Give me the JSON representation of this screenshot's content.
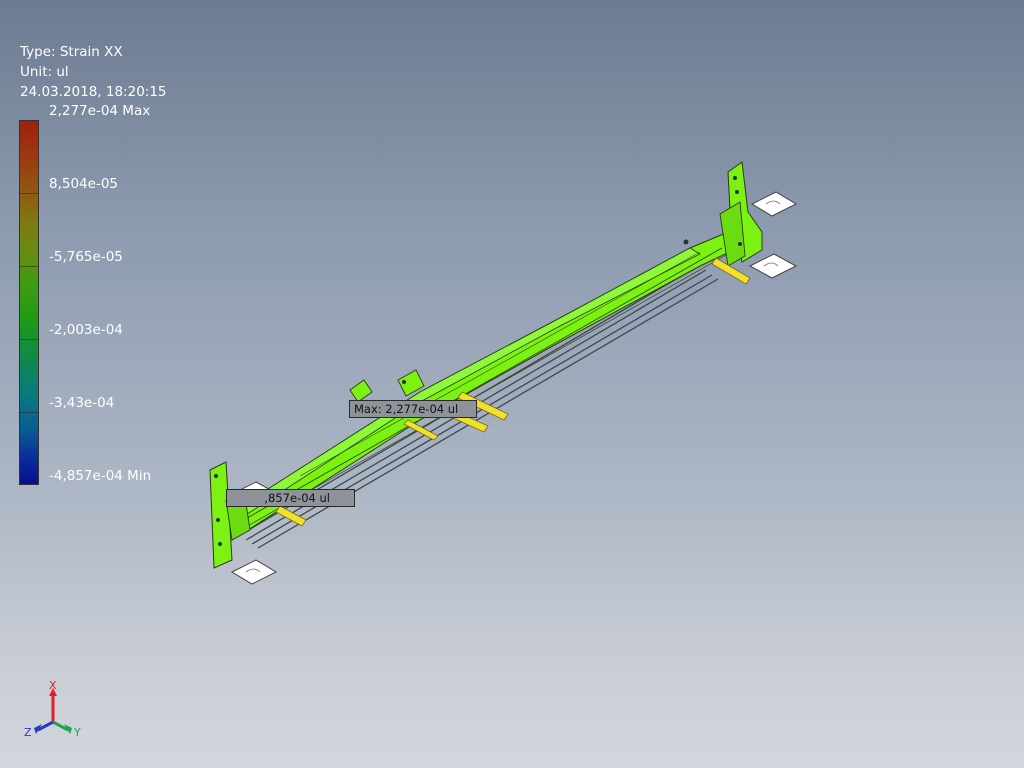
{
  "header": {
    "type_line": "Type: Strain XX",
    "unit_line": "Unit: ul",
    "date_line": "24.03.2018, 18:20:15"
  },
  "legend": {
    "labels": [
      "2,277e-04 Max",
      "8,504e-05",
      "-5,765e-05",
      "-2,003e-04",
      "-3,43e-04",
      "-4,857e-04 Min"
    ],
    "colors": [
      "#a0200e",
      "#7e7a10",
      "#3f9c12",
      "#0f8a48",
      "#0a5c94",
      "#080e94"
    ]
  },
  "probes": {
    "max_label": "Max: 2,277e-04 ul",
    "min_label": ",857e-04 ul"
  },
  "triad": {
    "x": "X",
    "y": "Y",
    "z": "Z"
  },
  "colors": {
    "model_green": "#7cf212",
    "bolt_yellow": "#f0e22a"
  }
}
